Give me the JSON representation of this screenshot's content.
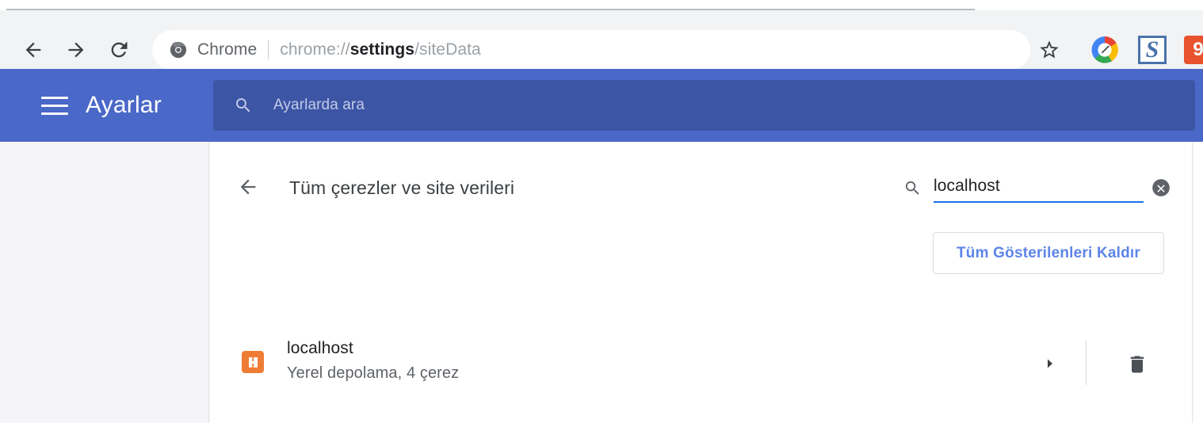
{
  "browser": {
    "nav": {
      "back_icon": "arrow-left-icon",
      "forward_icon": "arrow-right-icon",
      "reload_icon": "reload-icon"
    },
    "omnibox": {
      "chrome_logo_icon": "chrome-logo-icon",
      "scheme_label": "Chrome",
      "url_prefix": "chrome://",
      "url_strong": "settings",
      "url_suffix": "/siteData",
      "full_url": "chrome://settings/siteData"
    },
    "actions": {
      "bookmark_icon": "star-outline-icon",
      "extensions": [
        {
          "name": "google-pen-circle-extension-icon",
          "label": ""
        },
        {
          "name": "scribd-s-extension-icon",
          "label": "S"
        },
        {
          "name": "orange-extension-icon",
          "label": "9"
        }
      ]
    }
  },
  "settings_header": {
    "menu_icon": "hamburger-menu-icon",
    "title": "Ayarlar",
    "search": {
      "icon": "search-icon",
      "placeholder": "Ayarlarda ara",
      "value": ""
    },
    "background_color": "#4a68c8",
    "search_background_color": "#3c55a5"
  },
  "page": {
    "back_icon": "arrow-left-icon",
    "title": "Tüm çerezler ve site verileri",
    "search": {
      "icon": "search-icon",
      "value": "localhost",
      "clear_icon": "clear-circle-icon",
      "underline_color": "#1a73e8"
    },
    "remove_all_button": {
      "label": "Tüm Gösterilenleri Kaldır",
      "text_color": "#5c85e8"
    },
    "sites": [
      {
        "favicon_icon": "xampp-favicon-icon",
        "favicon_color": "#ef7c34",
        "title": "localhost",
        "subtitle": "Yerel depolama, 4 çerez",
        "expand_icon": "chevron-right-icon",
        "delete_icon": "trash-icon"
      }
    ]
  }
}
